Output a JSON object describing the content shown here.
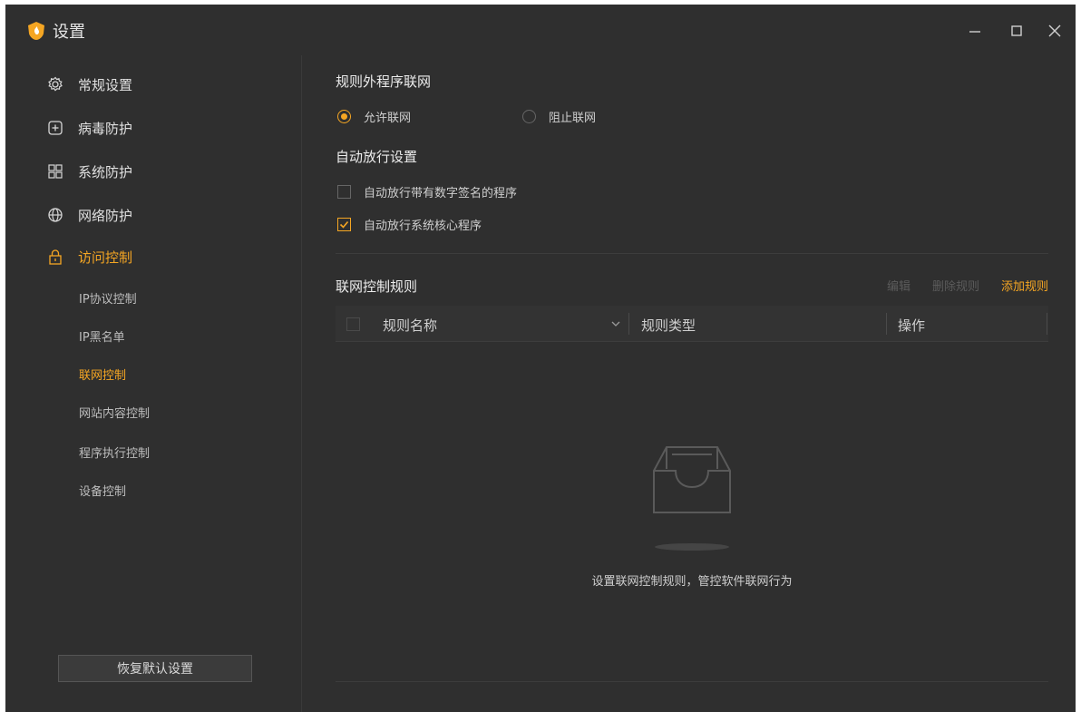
{
  "window": {
    "title": "设置",
    "controls": {
      "minimize": "—",
      "maximize": "□",
      "close": "✕"
    }
  },
  "sidebar": {
    "items": [
      {
        "label": "常规设置",
        "icon": "gear-icon"
      },
      {
        "label": "病毒防护",
        "icon": "plus-box-icon"
      },
      {
        "label": "系统防护",
        "icon": "grid-icon"
      },
      {
        "label": "网络防护",
        "icon": "globe-icon"
      },
      {
        "label": "访问控制",
        "icon": "lock-icon",
        "active": true
      }
    ],
    "sub_items": [
      {
        "label": "IP协议控制"
      },
      {
        "label": "IP黑名单"
      },
      {
        "label": "联网控制",
        "active": true
      },
      {
        "label": "网站内容控制"
      },
      {
        "label": "程序执行控制"
      },
      {
        "label": "设备控制"
      }
    ],
    "restore_label": "恢复默认设置"
  },
  "main": {
    "outside_rules": {
      "title": "规则外程序联网",
      "options": [
        {
          "label": "允许联网",
          "checked": true
        },
        {
          "label": "阻止联网",
          "checked": false
        }
      ]
    },
    "auto_allow": {
      "title": "自动放行设置",
      "options": [
        {
          "label": "自动放行带有数字签名的程序",
          "checked": false
        },
        {
          "label": "自动放行系统核心程序",
          "checked": true
        }
      ]
    },
    "rules": {
      "title": "联网控制规则",
      "actions": {
        "edit": "编辑",
        "delete": "删除规则",
        "add": "添加规则"
      },
      "columns": [
        "规则名称",
        "规则类型",
        "操作"
      ],
      "empty_text": "设置联网控制规则，管控软件联网行为"
    }
  },
  "colors": {
    "accent": "#f5a623",
    "background": "#2f2f2f",
    "text": "#d6d6d6"
  }
}
